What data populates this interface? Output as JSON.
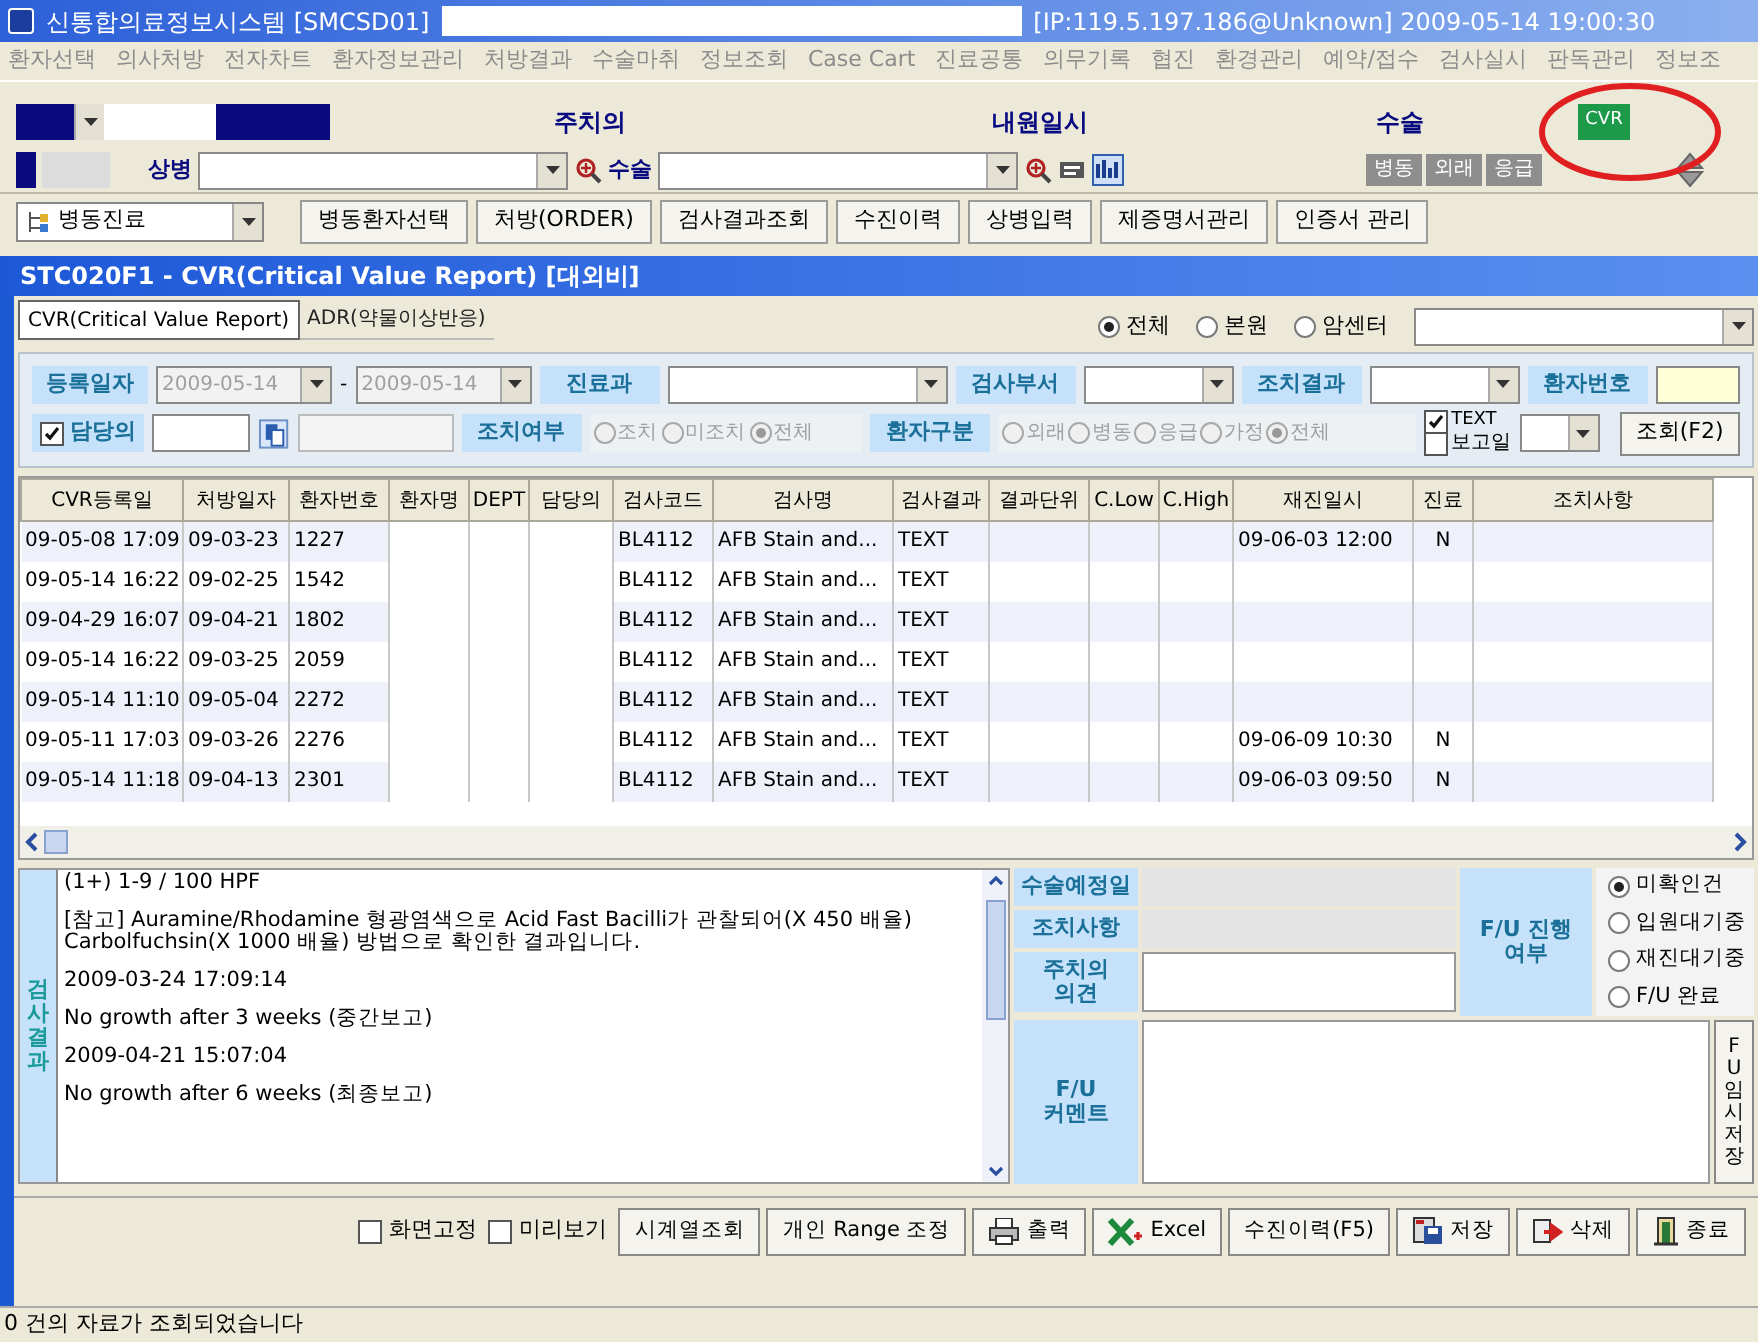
{
  "title_bar": {
    "app": "신통합의료정보시스템 [SMCSD01]",
    "info": "[IP:119.5.197.186@Unknown] 2009-05-14 19:00:30"
  },
  "menu": [
    "환자선택",
    "의사처방",
    "전자차트",
    "환자정보관리",
    "처방결과",
    "수술마취",
    "정보조회",
    "Case Cart",
    "진료공통",
    "의무기록",
    "협진",
    "환경관리",
    "예약/접수",
    "검사실시",
    "판독관리",
    "정보조"
  ],
  "patient_bar": {
    "labels": [
      "주치의",
      "내원일시",
      "수술"
    ],
    "cvr_button": "CVR",
    "diagnosis_label": "상병",
    "surgery_label": "수술",
    "mode_buttons": [
      "병동",
      "외래",
      "응급"
    ]
  },
  "toolbar": {
    "combo": "병동진료",
    "buttons": [
      "병동환자선택",
      "처방(ORDER)",
      "검사결과조회",
      "수진이력",
      "상병입력",
      "제증명서관리",
      "인증서 관리"
    ]
  },
  "subwindow": {
    "title": "STC020F1 - CVR(Critical Value Report) [대외비]"
  },
  "tabs": [
    {
      "label": "CVR(Critical Value Report)",
      "selected": true
    },
    {
      "label": "ADR(약물이상반응)",
      "selected": false
    }
  ],
  "site_filter": [
    {
      "label": "전체",
      "selected": true
    },
    {
      "label": "본원",
      "selected": false
    },
    {
      "label": "암센터",
      "selected": false
    }
  ],
  "filters": {
    "reg_date_label": "등록일자",
    "date_from": "2009-05-14",
    "date_to": "2009-05-14",
    "date_separator": "-",
    "dates_disabled": true,
    "dept_label": "진료과",
    "lab_label": "검사부서",
    "action_result_label": "조치결과",
    "patient_no_label": "환자번호",
    "doctor_label": "담당의",
    "doctor_checked": true,
    "action_label": "조치여부",
    "action_disabled": true,
    "action_options": [
      {
        "label": "조치",
        "selected": false
      },
      {
        "label": "미조치",
        "selected": false
      },
      {
        "label": "전체",
        "selected": true
      }
    ],
    "patient_type_label": "환자구분",
    "patient_type_disabled": true,
    "patient_type_options": [
      {
        "label": "외래",
        "selected": false
      },
      {
        "label": "병동",
        "selected": false
      },
      {
        "label": "응급",
        "selected": false
      },
      {
        "label": "가정",
        "selected": false
      },
      {
        "label": "전체",
        "selected": true
      }
    ],
    "text_label": "TEXT",
    "text_checked": true,
    "report_label": "보고일",
    "report_checked": false,
    "search_button": "조회(F2)"
  },
  "table": {
    "columns": [
      "CVR등록일",
      "처방일자",
      "환자번호",
      "환자명",
      "DEPT",
      "담당의",
      "검사코드",
      "검사명",
      "검사결과",
      "결과단위",
      "C.Low",
      "C.High",
      "재진일시",
      "진료",
      "조치사항"
    ],
    "rows": [
      {
        "registered": "09-05-08 17:09",
        "ordered": "09-03-23",
        "patient_no": "1227",
        "code": "BL4112",
        "test": "AFB Stain and...",
        "result": "TEXT",
        "revisit": "09-06-03 12:00",
        "visit": "N"
      },
      {
        "registered": "09-05-14 16:22",
        "ordered": "09-02-25",
        "patient_no": "1542",
        "code": "BL4112",
        "test": "AFB Stain and...",
        "result": "TEXT"
      },
      {
        "registered": "09-04-29 16:07",
        "ordered": "09-04-21",
        "patient_no": "1802",
        "code": "BL4112",
        "test": "AFB Stain and...",
        "result": "TEXT"
      },
      {
        "registered": "09-05-14 16:22",
        "ordered": "09-03-25",
        "patient_no": "2059",
        "code": "BL4112",
        "test": "AFB Stain and...",
        "result": "TEXT"
      },
      {
        "registered": "09-05-14 11:10",
        "ordered": "09-05-04",
        "patient_no": "2272",
        "code": "BL4112",
        "test": "AFB Stain and...",
        "result": "TEXT"
      },
      {
        "registered": "09-05-11 17:03",
        "ordered": "09-03-26",
        "patient_no": "2276",
        "code": "BL4112",
        "test": "AFB Stain and...",
        "result": "TEXT",
        "revisit": "09-06-09 10:30",
        "visit": "N"
      },
      {
        "registered": "09-05-14 11:18",
        "ordered": "09-04-13",
        "patient_no": "2301",
        "code": "BL4112",
        "test": "AFB Stain and...",
        "result": "TEXT",
        "revisit": "09-06-03 09:50",
        "visit": "N"
      }
    ]
  },
  "result_panel": {
    "label": "검사결과",
    "lines": [
      "(1+) 1-9 / 100 HPF",
      "[참고] Auramine/Rhodamine 형광염색으로 Acid Fast Bacilli가 관찰되어(X 450 배율) Carbolfuchsin(X 1000 배율) 방법으로 확인한 결과입니다.",
      "2009-03-24 17:09:14",
      "No growth after 3 weeks (중간보고)",
      "2009-04-21 15:07:04",
      "No growth after 6 weeks (최종보고)"
    ]
  },
  "followup": {
    "surgery_date_label": "수술예정일",
    "action_label": "조치사항",
    "opinion_label": "주치의 의견",
    "comment_label": "F/U 커멘트",
    "progress_label": "F/U 진행여부",
    "progress_options": [
      {
        "label": "미확인건",
        "selected": true
      },
      {
        "label": "입원대기중",
        "selected": false
      },
      {
        "label": "재진대기중",
        "selected": false
      },
      {
        "label": "F/U 완료",
        "selected": false
      }
    ],
    "temp_save_button": "FU임시저장"
  },
  "bottom_bar": {
    "checkboxes": [
      {
        "label": "화면고정",
        "checked": false
      },
      {
        "label": "미리보기",
        "checked": false
      }
    ],
    "buttons": [
      {
        "label": "시계열조회",
        "kind": "text"
      },
      {
        "label": "개인 Range 조정",
        "kind": "text"
      },
      {
        "label": "출력",
        "kind": "print"
      },
      {
        "label": "Excel",
        "kind": "excel"
      },
      {
        "label": "수진이력(F5)",
        "kind": "text"
      },
      {
        "label": "저장",
        "kind": "save"
      },
      {
        "label": "삭제",
        "kind": "delete"
      },
      {
        "label": "종료",
        "kind": "exit"
      }
    ]
  },
  "status_bar": "0 건의 자료가 조회되었습니다"
}
